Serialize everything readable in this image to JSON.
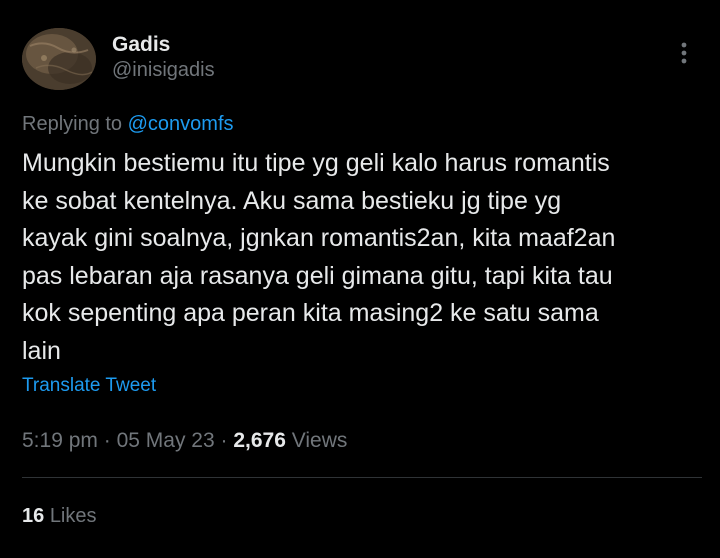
{
  "author": {
    "display_name": "Gadis",
    "handle": "@inisigadis"
  },
  "reply": {
    "prefix": "Replying to",
    "mention": "@convomfs"
  },
  "tweet": {
    "text": "Mungkin bestiemu itu tipe yg geli kalo harus romantis\nke sobat kentelnya. Aku sama bestieku jg tipe yg\nkayak gini soalnya, jgnkan romantis2an, kita maaf2an\npas lebaran aja rasanya geli gimana gitu, tapi kita tau\nkok sepenting apa peran kita masing2 ke satu sama\nlain",
    "translate_label": "Translate Tweet"
  },
  "meta": {
    "time": "5:19 pm",
    "separator": "·",
    "date": "05 May 23",
    "views_count": "2,676",
    "views_label": "Views"
  },
  "stats": {
    "likes_count": "16",
    "likes_label": "Likes"
  },
  "icons": {
    "more": "more-options-icon"
  },
  "colors": {
    "background": "#000000",
    "text": "#e7e9ea",
    "secondary": "#71767b",
    "accent": "#1d9bf0",
    "divider": "#2f3336"
  }
}
